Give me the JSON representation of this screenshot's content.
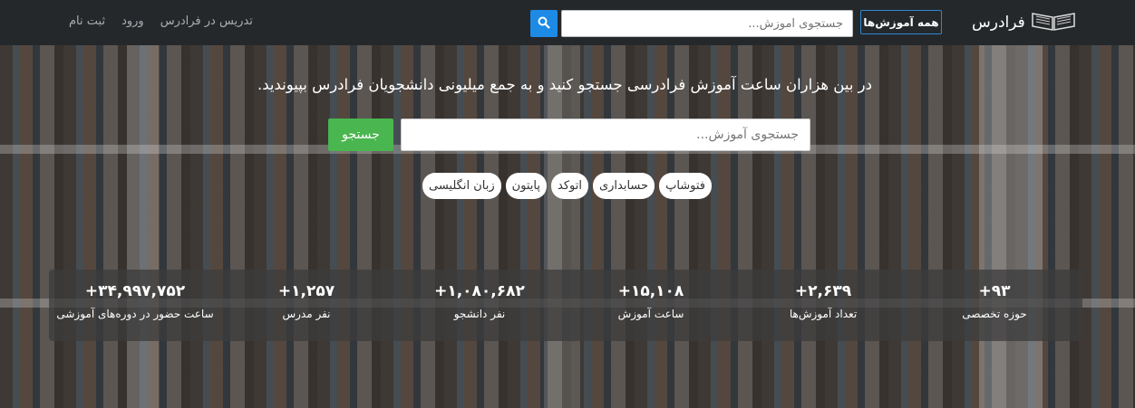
{
  "nav": {
    "brand": "فرادرس",
    "all_courses": "همه آموزش‌ها",
    "search_placeholder": "جستجوی آموزش...",
    "links": [
      "تدریس در فرادرس",
      "ورود",
      "ثبت نام"
    ]
  },
  "hero": {
    "tagline": "در بین هزاران ساعت آموزش فرادرسی جستجو کنید و به جمع میلیونی دانشجویان فرادرس بپیوندید.",
    "search_placeholder": "جستجوی آموزش...",
    "search_button": "جستجو",
    "tags": [
      "زبان انگلیسی",
      "پایتون",
      "اتوکد",
      "حسابداری",
      "فتوشاپ"
    ]
  },
  "stats": [
    {
      "num": "+۳۴,۹۹۷,۷۵۲",
      "label": "ساعت حضور در دوره‌های آموزشی"
    },
    {
      "num": "+۱,۲۵۷",
      "label": "نفر مدرس"
    },
    {
      "num": "+۱,۰۸۰,۶۸۲",
      "label": "نفر دانشجو"
    },
    {
      "num": "+۱۵,۱۰۸",
      "label": "ساعت آموزش"
    },
    {
      "num": "+۲,۶۳۹",
      "label": "تعداد آموزش‌ها"
    },
    {
      "num": "+۹۳",
      "label": "حوزه تخصصی"
    }
  ],
  "colors": {
    "navbar": "#25282b",
    "accent_blue": "#1d8ae6",
    "search_green": "#4ab650"
  }
}
